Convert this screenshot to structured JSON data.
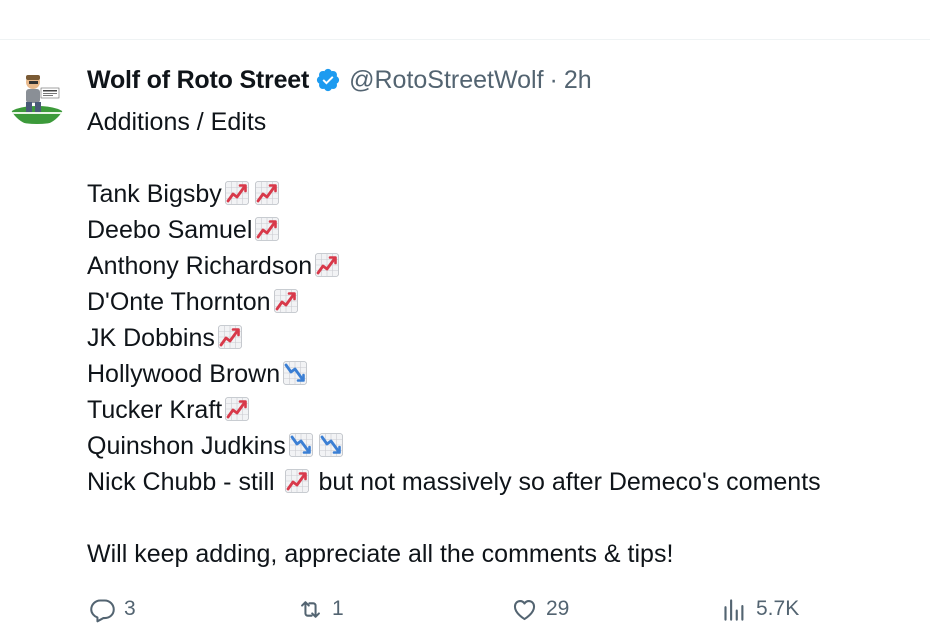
{
  "tweet": {
    "display_name": "Wolf of Roto Street",
    "handle": "@RotoStreetWolf",
    "separator": "·",
    "time": "2h",
    "verified": true,
    "lines": {
      "intro": "Additions / Edits",
      "l1": "Tank Bigsby",
      "l2": "Deebo Samuel",
      "l3": "Anthony Richardson",
      "l4": "D'Onte Thornton",
      "l5": "JK Dobbins",
      "l6": "Hollywood Brown",
      "l7": "Tucker Kraft",
      "l8": "Quinshon Judkins",
      "l9a": "Nick Chubb - still ",
      "l9b": " but not massively so after Demeco's coments",
      "outro": "Will keep adding, appreciate all the comments & tips!"
    },
    "emoji_meaning": {
      "chart-increasing": "trending up",
      "chart-decreasing": "trending down"
    }
  },
  "actions": {
    "replies": "3",
    "retweets": "1",
    "likes": "29",
    "views": "5.7K"
  },
  "colors": {
    "text": "#0f1419",
    "secondary": "#536471",
    "verified": "#1d9bf0",
    "up": "#d8394a",
    "down": "#3b7fd4"
  }
}
